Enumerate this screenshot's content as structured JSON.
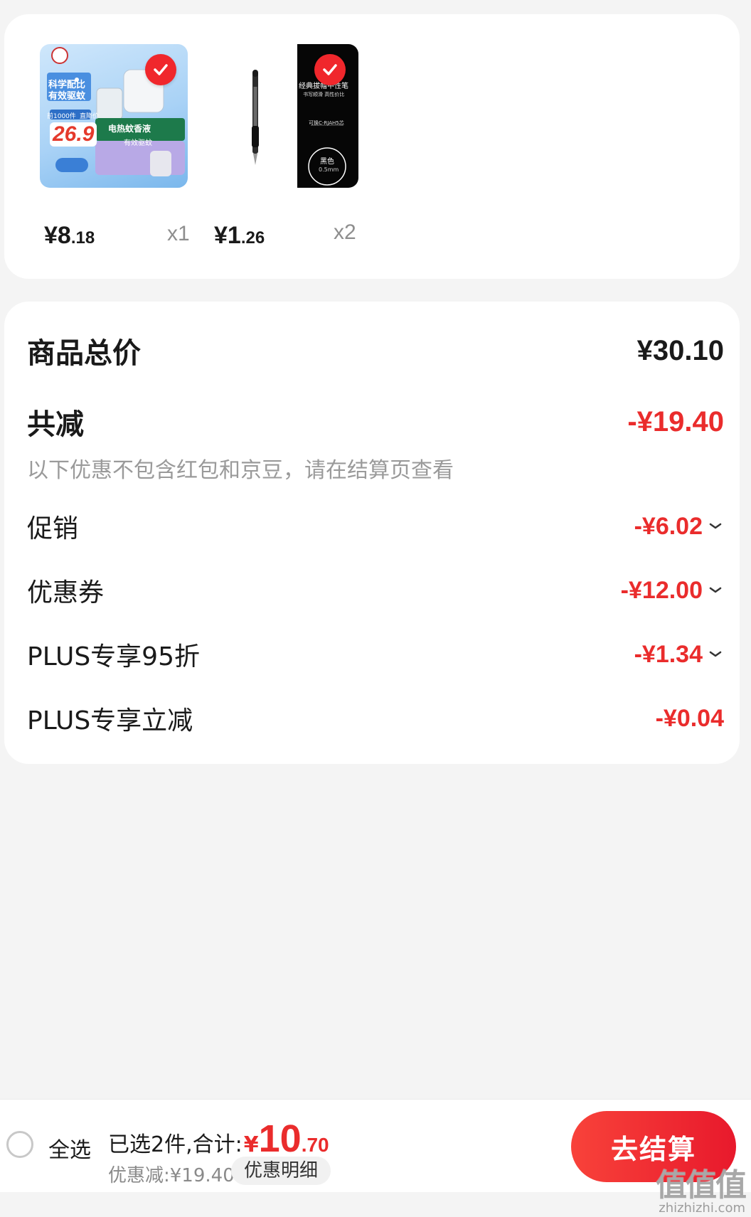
{
  "products": [
    {
      "price_int": "¥8",
      "price_dec": ".18",
      "qty": "x1",
      "image_text": {
        "line1": "科学配比",
        "line2": "有效驱蚊",
        "tag": "前1000件",
        "tag2": "直降价",
        "promo": "26.9",
        "name": "电热蚊香液",
        "sub": "有效驱蚊"
      }
    },
    {
      "price_int": "¥1",
      "price_dec": ".26",
      "qty": "x2",
      "image_text": {
        "line1": "经典拔帽中性笔",
        "line2": "书写顺滑 高性价比",
        "line3": "可换C-RJAH5芯",
        "color": "黑色",
        "size": "0.5mm"
      }
    }
  ],
  "summary": {
    "total_label": "商品总价",
    "total_value": "¥30.10",
    "reduce_label": "共减",
    "reduce_value": "-¥19.40",
    "note": "以下优惠不包含红包和京豆，请在结算页查看",
    "items": [
      {
        "label": "促销",
        "value": "-¥6.02",
        "expandable": true
      },
      {
        "label": "优惠券",
        "value": "-¥12.00",
        "expandable": true
      },
      {
        "label": "PLUS专享95折",
        "value": "-¥1.34",
        "expandable": true
      },
      {
        "label": "PLUS专享立减",
        "value": "-¥0.04",
        "expandable": false
      }
    ]
  },
  "bottom": {
    "select_all": "全选",
    "selected": "已选2件,合计:",
    "yen": "¥",
    "total_int": "10",
    "total_dec": ".70",
    "discount": "优惠减:¥19.40",
    "detail_button": "优惠明细",
    "checkout_button": "去结算"
  },
  "watermark": {
    "main": "值值值",
    "sub": "zhizhizhi.com"
  },
  "colors": {
    "accent_red": "#ea2c2c",
    "check_red": "#f0272c"
  }
}
